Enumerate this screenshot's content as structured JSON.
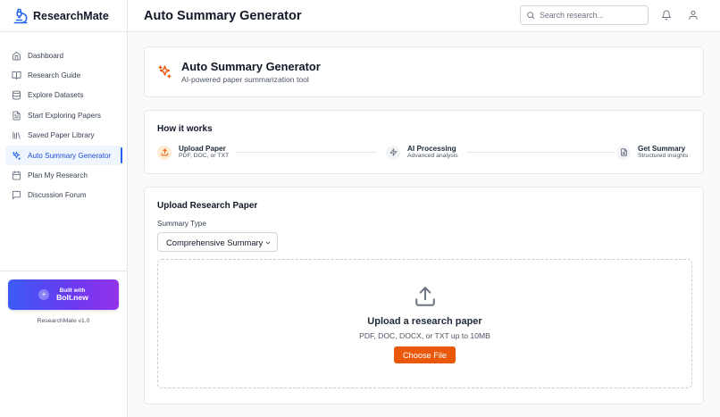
{
  "app": {
    "name": "ResearchMate",
    "version": "ResearchMate v1.0"
  },
  "sidebar": {
    "items": [
      {
        "label": "Dashboard",
        "icon": "home-icon"
      },
      {
        "label": "Research Guide",
        "icon": "book-open-icon"
      },
      {
        "label": "Explore Datasets",
        "icon": "database-icon"
      },
      {
        "label": "Start Exploring Papers",
        "icon": "file-text-icon"
      },
      {
        "label": "Saved Paper Library",
        "icon": "library-icon"
      },
      {
        "label": "Auto Summary Generator",
        "icon": "sparkles-icon",
        "active": true
      },
      {
        "label": "Plan My Research",
        "icon": "calendar-icon"
      },
      {
        "label": "Discussion Forum",
        "icon": "message-square-icon"
      }
    ],
    "bolt": {
      "line1": "Built with",
      "line2": "Bolt.new"
    }
  },
  "header": {
    "title": "Auto Summary Generator",
    "search_placeholder": "Search research..."
  },
  "hero": {
    "title": "Auto Summary Generator",
    "subtitle": "AI-powered paper summarization tool"
  },
  "how": {
    "title": "How it works",
    "steps": [
      {
        "name": "Upload Paper",
        "desc": "PDF, DOC, or TXT",
        "icon": "upload-icon"
      },
      {
        "name": "AI Processing",
        "desc": "Advanced analysis",
        "icon": "zap-icon"
      },
      {
        "name": "Get Summary",
        "desc": "Structured insights",
        "icon": "file-text-icon"
      }
    ]
  },
  "upload": {
    "title": "Upload Research Paper",
    "summary_type_label": "Summary Type",
    "summary_type_value": "Comprehensive Summary",
    "dropzone_title": "Upload a research paper",
    "dropzone_sub": "PDF, DOC, DOCX, or TXT up to 10MB",
    "choose_label": "Choose File"
  },
  "colors": {
    "accent": "#ea580c",
    "primary": "#2563eb"
  }
}
